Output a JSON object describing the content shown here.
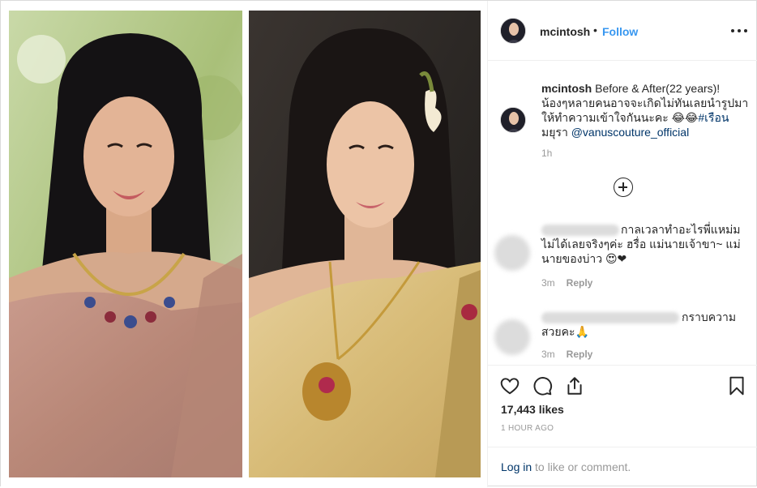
{
  "post": {
    "username": "mcintosh",
    "dot": "•",
    "follow_label": "Follow",
    "more_icon": "more-horizontal-icon",
    "caption": {
      "username": "mcintosh",
      "line1": "Before & After(22 years)!",
      "line2": "น้องๆหลายคนอาจจะเกิดไม่ทันเลยนำรูปมา",
      "line3_pre": "ให้ทำความเข้าใจกันนะคะ ",
      "emoji": "😂😂",
      "hashtag": "#เรือน",
      "line4_pre": "มยุรา ",
      "mention": "@vanuscouture_official",
      "time": "1h"
    },
    "load_more_icon": "plus-circle-icon",
    "comments": [
      {
        "username_blurred": true,
        "text_line1": "กาลเวลาทำอะไรพี่แหม่ม",
        "text_line2": "ไม่ได้เลยจริงๆค่ะ ฮรื่อ แม่นายเจ้าขา~ แม่",
        "text_line3": "นายของบ่าว 😍❤",
        "time": "3m",
        "reply_label": "Reply"
      },
      {
        "username_blurred": true,
        "text_line1": "กราบความ",
        "text_line2": "สวยคะ🙏",
        "time": "3m",
        "reply_label": "Reply"
      }
    ],
    "actions": {
      "like_icon": "heart-icon",
      "comment_icon": "comment-icon",
      "share_icon": "share-icon",
      "save_icon": "bookmark-icon"
    },
    "likes": "17,443 likes",
    "posted_ago": "1 HOUR AGO",
    "login_link": "Log in",
    "login_rest": " to like or comment."
  },
  "colors": {
    "link_blue": "#3897f0",
    "mention_dark_blue": "#003569",
    "muted_gray": "#999999",
    "border": "#dbdbdb"
  }
}
